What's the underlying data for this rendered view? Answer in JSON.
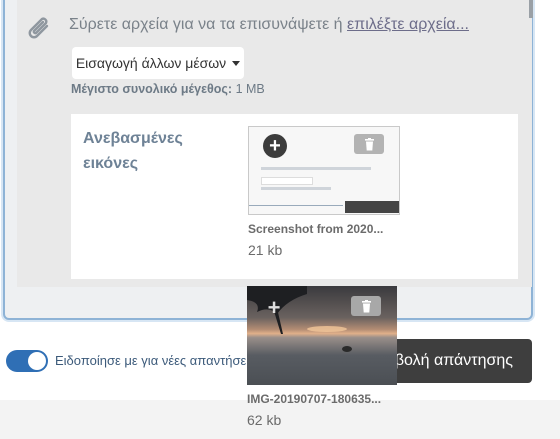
{
  "upload": {
    "drop_text": "Σύρετε αρχεία για να τα επισυνάψετε ή ",
    "choose_link": "επιλέξτε αρχεία...",
    "media_button": "Εισαγωγή άλλων μέσων",
    "max_size_label": "Μέγιστο συνολικό μέγεθος:",
    "max_size_value": " 1 MB"
  },
  "uploaded": {
    "title": "Ανεβασμένες εικόνες",
    "files": [
      {
        "name": "Screenshot from 2020...",
        "size": "21 kb"
      },
      {
        "name": "IMG-20190707-180635...",
        "size": "62 kb"
      }
    ]
  },
  "footer": {
    "notify_label": "Ειδοποίησε με για νέες απαντήσε",
    "submit_label": "βολή απάντησης"
  },
  "colors": {
    "accent": "#2f6fb5",
    "focus_border": "#8eb3d6",
    "submit_bg": "#3e3e3e"
  }
}
